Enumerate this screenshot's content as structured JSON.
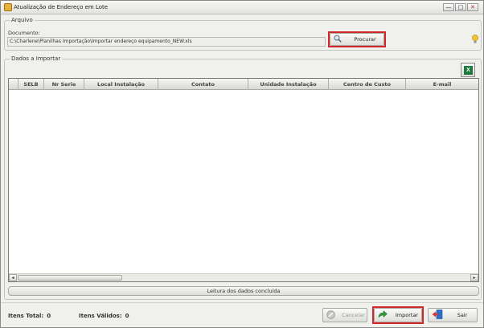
{
  "window": {
    "title": "Atualização de Endereço em Lote",
    "buttons": [
      "—",
      "□",
      "✕"
    ]
  },
  "arquivo": {
    "legend": "Arquivo",
    "doc_label": "Documento:",
    "doc_value": "C:\\Charlene\\Planilhas Importação\\Importar endereço equipamento_NEW.xls",
    "browse_label": "Procurar"
  },
  "dados": {
    "legend": "Dados a Importar",
    "columns": [
      "",
      "SELB",
      "Nr Serie",
      "Local Instalação",
      "Contato",
      "Unidade Instalação",
      "Centro de Custo",
      "E-mail"
    ],
    "rows": [],
    "status": "Leitura dos dados concluída"
  },
  "footer": {
    "total_label": "Itens Total:",
    "total_value": "0",
    "valid_label": "Itens Válidos:",
    "valid_value": "0",
    "cancel_label": "Cancelar",
    "import_label": "Importar",
    "exit_label": "Sair"
  },
  "icons": {
    "app": "document-icon",
    "browse": "magnifier-icon",
    "hint": "lightbulb-icon",
    "export": "excel-icon",
    "cancel": "cancel-icon",
    "import": "import-arrow-icon",
    "exit": "exit-door-icon"
  },
  "colors": {
    "highlight": "#d3262b",
    "excel": "#1f7a3e",
    "import_arrow": "#2e9a3a",
    "exit": "#2a6fc9"
  }
}
